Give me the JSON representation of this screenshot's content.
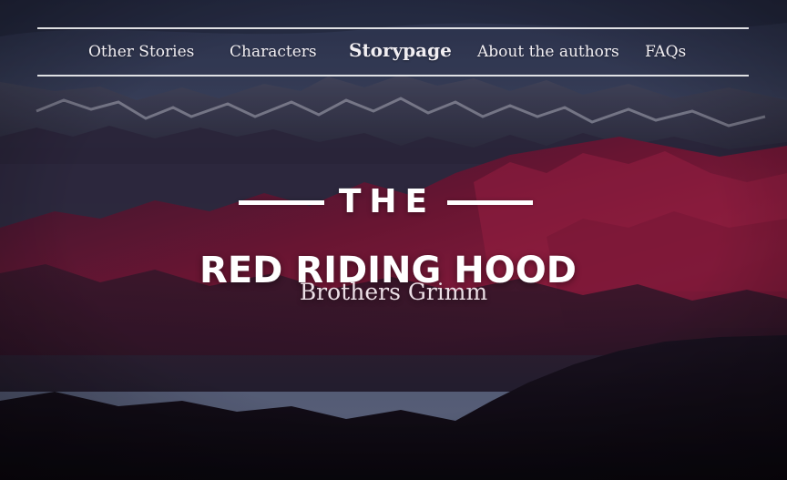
{
  "nav": {
    "items": [
      {
        "label": "Other Stories",
        "active": false
      },
      {
        "label": "Characters",
        "active": false
      },
      {
        "label": "Storypage",
        "active": true
      },
      {
        "label": "About the authors",
        "active": false
      },
      {
        "label": "FAQs",
        "active": false
      }
    ]
  },
  "hero": {
    "pretitle": "THE",
    "title": "RED RIDING HOOD",
    "author": "Brothers Grimm"
  },
  "background": {
    "description_icon": "mountain-landscape-image",
    "colors": {
      "sky_top": "#3d4866",
      "sky_low": "#5b6a86",
      "mountain_red": "#8a1c3c",
      "mountain_dark": "#221a2a",
      "foreground": "#0d0b12"
    }
  }
}
